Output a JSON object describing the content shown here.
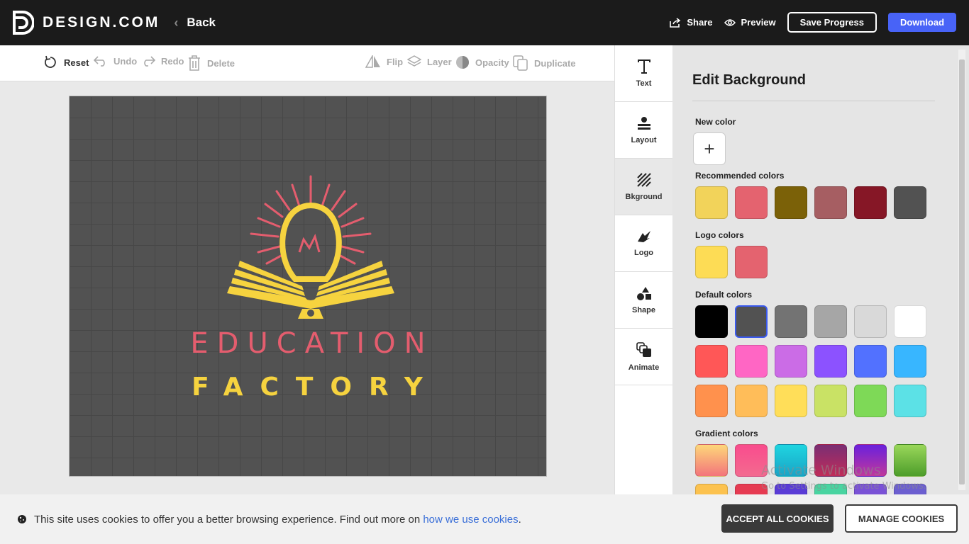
{
  "header": {
    "brand": "DESIGN.COM",
    "back_label": "Back",
    "share_label": "Share",
    "preview_label": "Preview",
    "save_label": "Save Progress",
    "download_label": "Download",
    "download_color": "#4863f7"
  },
  "toolbar": {
    "reset": "Reset",
    "undo": "Undo",
    "redo": "Redo",
    "delete": "Delete",
    "flip": "Flip",
    "layer": "Layer",
    "opacity": "Opacity",
    "duplicate": "Duplicate"
  },
  "canvas": {
    "background_color": "#525252",
    "logo_line1": "EDUCATION",
    "logo_line2": "FACTORY",
    "line1_color": "#e45d6e",
    "line2_color": "#f6d33f"
  },
  "menu": {
    "items": [
      {
        "label": "Text",
        "icon": "text-icon"
      },
      {
        "label": "Layout",
        "icon": "layout-icon"
      },
      {
        "label": "Bkground",
        "icon": "background-icon",
        "active": true
      },
      {
        "label": "Logo",
        "icon": "logo-icon"
      },
      {
        "label": "Shape",
        "icon": "shape-icon"
      },
      {
        "label": "Animate",
        "icon": "animate-icon"
      }
    ]
  },
  "panel": {
    "title": "Edit Background",
    "new_color_label": "New color",
    "recommended_label": "Recommended colors",
    "recommended": [
      "#f2d35a",
      "#e4636f",
      "#7b6108",
      "#a65e62",
      "#861726",
      "#525252"
    ],
    "logo_colors_label": "Logo colors",
    "logo_colors": [
      "#fddc55",
      "#e4636f"
    ],
    "default_label": "Default colors",
    "default_rows": [
      [
        "#000000",
        "#525252",
        "#737373",
        "#a6a6a6",
        "#d9d9d9",
        "#ffffff"
      ],
      [
        "#ff5757",
        "#ff66c4",
        "#cb6ce6",
        "#8c52ff",
        "#5271ff",
        "#38b6ff"
      ],
      [
        "#ff914d",
        "#ffbd59",
        "#ffde59",
        "#c9e265",
        "#7ed957",
        "#5ce1e6"
      ]
    ],
    "default_selected": "#525252",
    "gradient_label": "Gradient colors",
    "gradients": [
      "linear-gradient(180deg, #fdd77a, #f3747b)",
      "linear-gradient(180deg, #f94c8d, #f36a8f)",
      "linear-gradient(180deg, #1fd5e0, #19a4c6)",
      "linear-gradient(180deg, #7a2e74, #c02c59)",
      "linear-gradient(180deg, #6a20dd, #c0389c)",
      "linear-gradient(180deg, #9ad75a, #4d9d2a)"
    ],
    "gradients_row2": [
      "#fcc24f",
      "#e63b52",
      "#5a3cd6",
      "#49d4a1",
      "#7a52d6",
      "#6c5fd0"
    ]
  },
  "watermark": {
    "line1": "Activate Windows",
    "line2": "Go to Settings to activate Windows."
  },
  "cookies": {
    "text": "This site uses cookies to offer you a better browsing experience. Find out more on ",
    "link": "how we use cookies",
    "period": ".",
    "accept": "ACCEPT ALL COOKIES",
    "manage": "MANAGE COOKIES"
  }
}
